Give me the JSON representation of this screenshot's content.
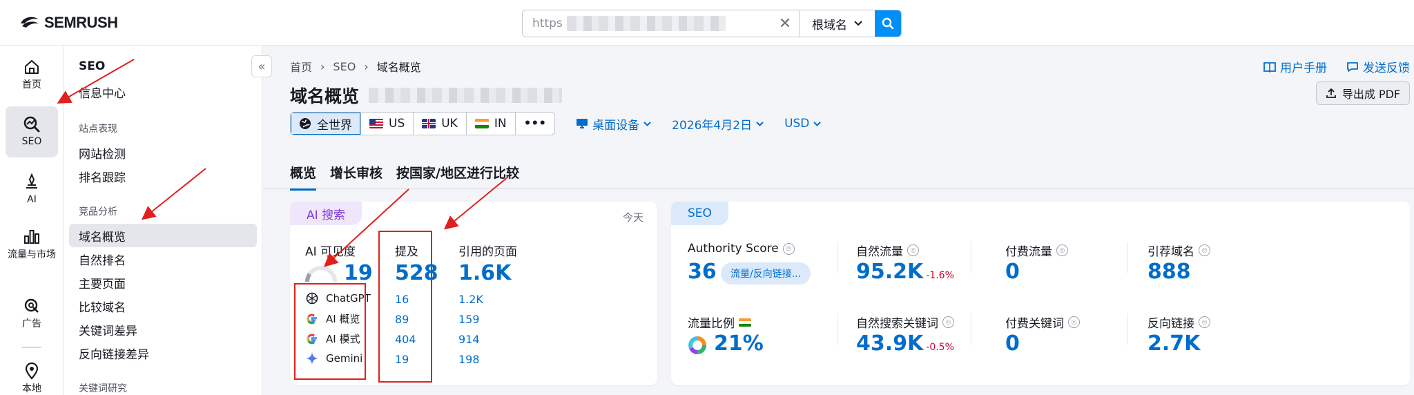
{
  "brand": {
    "name": "SEMRUSH"
  },
  "search": {
    "value": "https",
    "scope": "根域名"
  },
  "rail": [
    {
      "label": "首页",
      "icon": "home-icon"
    },
    {
      "label": "SEO",
      "icon": "seo-icon"
    },
    {
      "label": "AI",
      "icon": "ai-icon"
    },
    {
      "label": "流量与市场",
      "icon": "traffic-icon"
    },
    {
      "label": "广告",
      "icon": "ads-icon"
    },
    {
      "label": "本地",
      "icon": "local-icon"
    }
  ],
  "subnav": {
    "title": "SEO",
    "info_center": "信息中心",
    "group_site": "站点表现",
    "site_audit": "网站检测",
    "rank_track": "排名跟踪",
    "group_comp": "竞品分析",
    "domain_overview": "域名概览",
    "organic": "自然排名",
    "top_pages": "主要页面",
    "compare": "比较域名",
    "kw_gap": "关键词差异",
    "bl_gap": "反向链接差异",
    "group_kw": "关键词研究"
  },
  "breadcrumb": {
    "home": "首页",
    "seo": "SEO",
    "current": "域名概览"
  },
  "links": {
    "manual": "用户手册",
    "feedback": "发送反馈"
  },
  "title": "域名概览",
  "pdf": "导出成 PDF",
  "filters": {
    "global": "全世界",
    "us": "US",
    "uk": "UK",
    "in": "IN",
    "more": "•••",
    "device": "桌面设备",
    "date": "2026年4月2日",
    "currency": "USD"
  },
  "tabs": [
    "概览",
    "增长审核",
    "按国家/地区进行比较"
  ],
  "ai_card": {
    "tag": "AI 搜索",
    "today": "今天",
    "visibility_label": "AI 可见度",
    "visibility_value": "19",
    "visibility_fraction": 0.19,
    "mentions_label": "提及",
    "mentions_value": "528",
    "pages_label": "引用的页面",
    "pages_value": "1.6K",
    "rows": [
      {
        "name": "ChatGPT",
        "mentions": "16",
        "pages": "1.2K"
      },
      {
        "name": "AI 概览",
        "mentions": "89",
        "pages": "159"
      },
      {
        "name": "AI 模式",
        "mentions": "404",
        "pages": "914"
      },
      {
        "name": "Gemini",
        "mentions": "19",
        "pages": "198"
      }
    ]
  },
  "seo_card": {
    "tag": "SEO",
    "authority_label": "Authority Score",
    "authority_value": "36",
    "authority_pill": "流量/反向链接...",
    "organic_label": "自然流量",
    "organic_value": "95.2K",
    "organic_delta": "-1.6%",
    "paid_label": "付费流量",
    "paid_value": "0",
    "ref_label": "引荐域名",
    "ref_value": "888",
    "ratio_label": "流量比例",
    "ratio_value": "21%",
    "organic_kw_label": "自然搜索关键词",
    "organic_kw_value": "43.9K",
    "organic_kw_delta": "-0.5%",
    "paid_kw_label": "付费关键词",
    "paid_kw_value": "0",
    "backlinks_label": "反向链接",
    "backlinks_value": "2.7K"
  },
  "colors": {
    "accent": "#006dca",
    "search_btn": "#008ff8",
    "annotation": "#e0201c",
    "negative": "#d1002f"
  }
}
